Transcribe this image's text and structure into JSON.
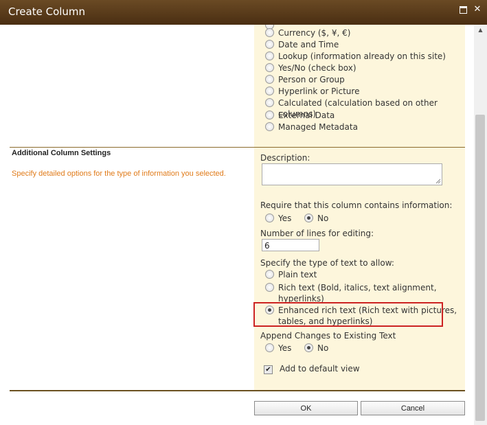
{
  "window": {
    "title": "Create Column"
  },
  "column_types": [
    {
      "label": "Currency ($, ¥, €)",
      "checked": false
    },
    {
      "label": "Date and Time",
      "checked": false
    },
    {
      "label": "Lookup (information already on this site)",
      "checked": false
    },
    {
      "label": "Yes/No (check box)",
      "checked": false
    },
    {
      "label": "Person or Group",
      "checked": false
    },
    {
      "label": "Hyperlink or Picture",
      "checked": false
    },
    {
      "label": "Calculated (calculation based on other columns)",
      "checked": false
    },
    {
      "label": "External Data",
      "checked": false
    },
    {
      "label": "Managed Metadata",
      "checked": false
    }
  ],
  "additional": {
    "heading": "Additional Column Settings",
    "description": "Specify detailed options for the type of information you selected."
  },
  "description_field": {
    "label": "Description:",
    "value": ""
  },
  "required": {
    "label": "Require that this column contains information:",
    "yes": "Yes",
    "no": "No",
    "selected": "No"
  },
  "lines": {
    "label": "Number of lines for editing:",
    "value": "6"
  },
  "text_type": {
    "label": "Specify the type of text to allow:",
    "plain": "Plain text",
    "rich_line1": "Rich text (Bold, italics, text alignment,",
    "rich_line2": "hyperlinks)",
    "enhanced_line1": "Enhanced rich text (Rich text with pictures,",
    "enhanced_line2": "tables, and hyperlinks)",
    "selected": "Enhanced rich text"
  },
  "append": {
    "label": "Append Changes to Existing Text",
    "yes": "Yes",
    "no": "No",
    "selected": "No"
  },
  "default_view": {
    "label": "Add to default view",
    "checked": true
  },
  "buttons": {
    "ok": "OK",
    "cancel": "Cancel"
  }
}
